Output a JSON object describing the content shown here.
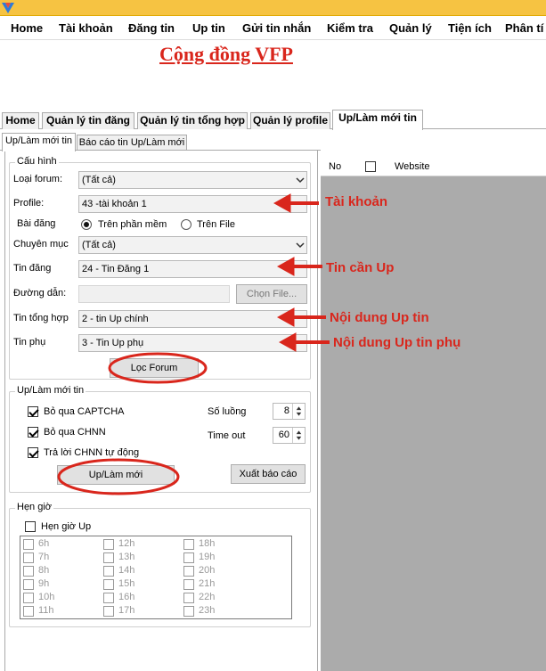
{
  "menu": [
    "Home",
    "Tài khoản",
    "Đăng tin",
    "Up tin",
    "Gửi tin nhắn",
    "Kiểm tra",
    "Quản lý",
    "Tiện ích",
    "Phân tí"
  ],
  "brand": "Cộng đồng VFP",
  "main_tabs": [
    "Home",
    "Quản lý tin đăng",
    "Quản lý tin tổng hợp",
    "Quản lý profile",
    "Up/Làm mới tin"
  ],
  "sub_tabs": [
    "Up/Làm mới tin",
    "Báo cáo tin Up/Làm mới"
  ],
  "config": {
    "legend": "Cấu hình",
    "forum_type_label": "Loại forum:",
    "forum_type_value": "(Tất cả)",
    "profile_label": "Profile:",
    "profile_value": "43 -tài khoản 1",
    "post_label": "Bài đăng",
    "radio_software": "Trên phần mềm",
    "radio_file": "Trên File",
    "category_label": "Chuyên mục",
    "category_value": "(Tất cả)",
    "tin_dang_label": "Tin đăng",
    "tin_dang_value": "24 - Tin Đăng 1",
    "path_label": "Đường dẫn:",
    "path_value": "",
    "choose_file": "Chọn File...",
    "tin_tong_hop_label": "Tin tổng hợp",
    "tin_tong_hop_value": "2 - tin Up chính",
    "tin_phu_label": "Tin phụ",
    "tin_phu_value": "3 - Tin Up phụ",
    "filter_button": "Lọc Forum"
  },
  "up": {
    "legend": "Up/Làm mới tin",
    "skip_captcha": "Bỏ qua CAPTCHA",
    "skip_chnn": "Bỏ qua CHNN",
    "auto_reply": "Trả lời CHNN tự động",
    "threads_label": "Số luồng",
    "threads_value": "8",
    "timeout_label": "Time out",
    "timeout_value": "60",
    "up_button": "Up/Làm mới",
    "export_button": "Xuất báo cáo"
  },
  "schedule": {
    "legend": "Hẹn giờ",
    "enable_label": "Hẹn giờ Up",
    "hours": [
      "6h",
      "7h",
      "8h",
      "9h",
      "10h",
      "11h",
      "12h",
      "13h",
      "14h",
      "15h",
      "16h",
      "17h",
      "18h",
      "19h",
      "20h",
      "21h",
      "22h",
      "23h"
    ]
  },
  "grid": {
    "col_no": "No",
    "col_website": "Website"
  },
  "annotations": {
    "account": "Tài khoản",
    "tin_can_up": "Tin cần Up",
    "noi_dung": "Nội dung Up tin",
    "noi_dung_phu": "Nội dung Up tin phụ"
  },
  "colors": {
    "annotation": "#d9261c",
    "titlebar": "#f6c342",
    "grid_bg": "#ababab"
  }
}
